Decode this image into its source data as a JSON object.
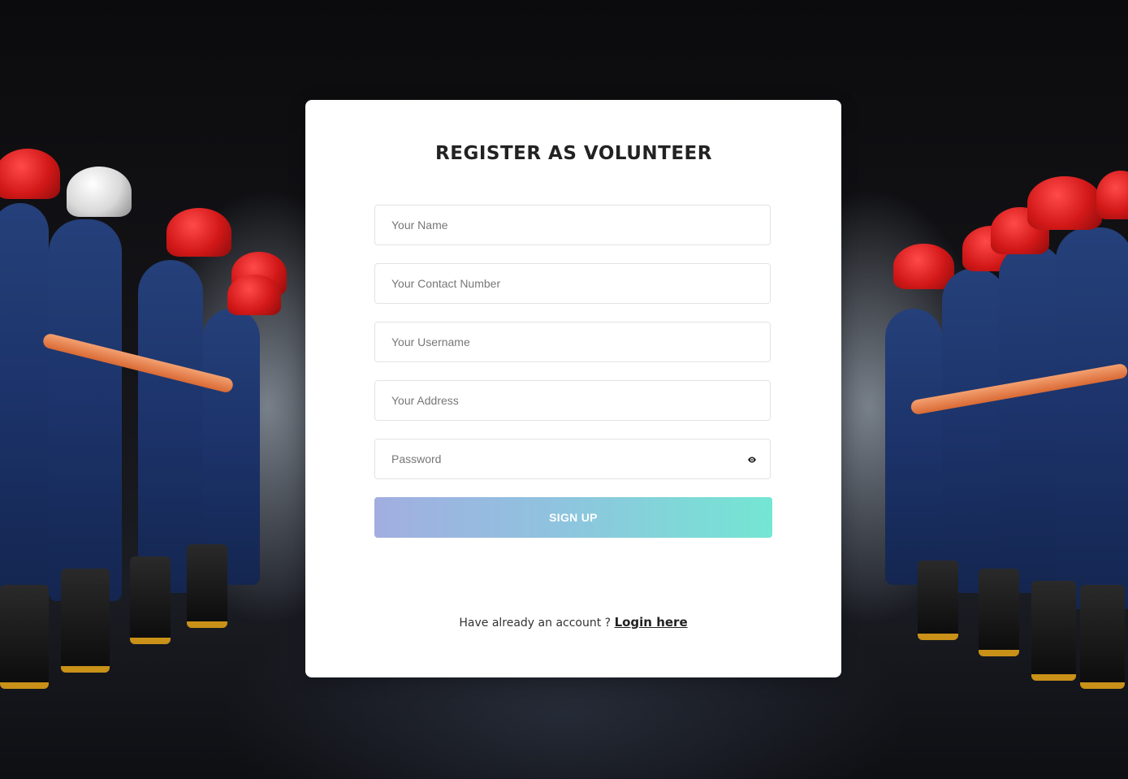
{
  "page": {
    "title": "REGISTER AS VOLUNTEER"
  },
  "form": {
    "name_placeholder": "Your Name",
    "contact_placeholder": "Your Contact Number",
    "username_placeholder": "Your Username",
    "address_placeholder": "Your Address",
    "password_placeholder": "Password",
    "password_toggle_icon": "eye-icon",
    "signup_label": "SIGN UP"
  },
  "footer": {
    "prompt_text": "Have already an account ?",
    "login_link_label": "Login here"
  },
  "colors": {
    "button_gradient_start": "#a2aee0",
    "button_gradient_end": "#74e6d3",
    "card_background": "#ffffff",
    "title_color": "#222222"
  },
  "background": {
    "subject": "firefighters-in-blue-uniforms-red-helmets"
  }
}
